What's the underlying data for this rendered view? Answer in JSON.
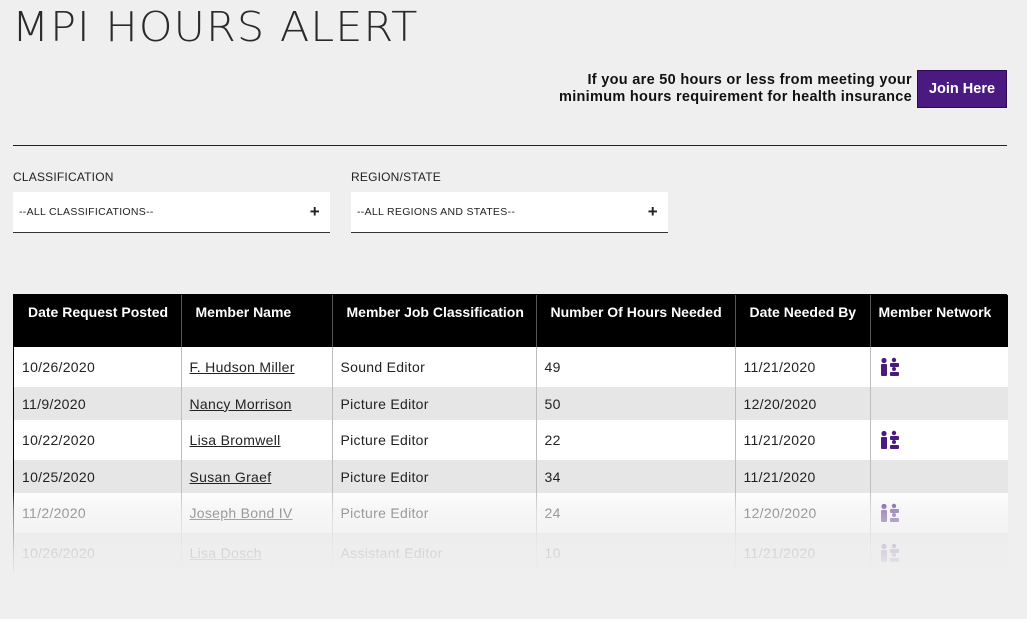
{
  "page": {
    "title": "MPI HOURS ALERT"
  },
  "promo": {
    "line1": "If you are 50 hours or less from meeting your",
    "line2": "minimum hours requirement for health insurance",
    "button_label": "Join Here",
    "button_color": "#4a1a80"
  },
  "filters": {
    "classification": {
      "label": "CLASSIFICATION",
      "value": "--ALL CLASSIFICATIONS--",
      "icon": "plus-icon"
    },
    "region": {
      "label": "REGION/STATE",
      "value": "--ALL REGIONS AND STATES--",
      "icon": "plus-icon"
    }
  },
  "table": {
    "headers": [
      "Date Request Posted",
      "Member Name",
      "Member Job Classification",
      "Number Of Hours Needed",
      "Date Needed By",
      "Member Network"
    ],
    "rows": [
      {
        "date_posted": "10/26/2020",
        "member_name": "F. Hudson Miller",
        "classification": "Sound Editor",
        "hours": "49",
        "date_needed": "11/21/2020",
        "network": true
      },
      {
        "date_posted": "11/9/2020",
        "member_name": "Nancy Morrison",
        "classification": "Picture Editor",
        "hours": "50",
        "date_needed": "12/20/2020",
        "network": false
      },
      {
        "date_posted": "10/22/2020",
        "member_name": "Lisa Bromwell",
        "classification": "Picture Editor",
        "hours": "22",
        "date_needed": "11/21/2020",
        "network": true
      },
      {
        "date_posted": "10/25/2020",
        "member_name": "Susan Graef",
        "classification": "Picture Editor",
        "hours": "34",
        "date_needed": "11/21/2020",
        "network": false
      },
      {
        "date_posted": "11/2/2020",
        "member_name": "Joseph Bond IV",
        "classification": "Picture Editor",
        "hours": "24",
        "date_needed": "12/20/2020",
        "network": true
      },
      {
        "date_posted": "10/26/2020",
        "member_name": "Lisa Dosch",
        "classification": "Assistant Editor",
        "hours": "10",
        "date_needed": "11/21/2020",
        "network": true
      }
    ],
    "network_icon": "member-network-icon",
    "header_bg": "#000000",
    "network_icon_color": "#4a1a80"
  }
}
